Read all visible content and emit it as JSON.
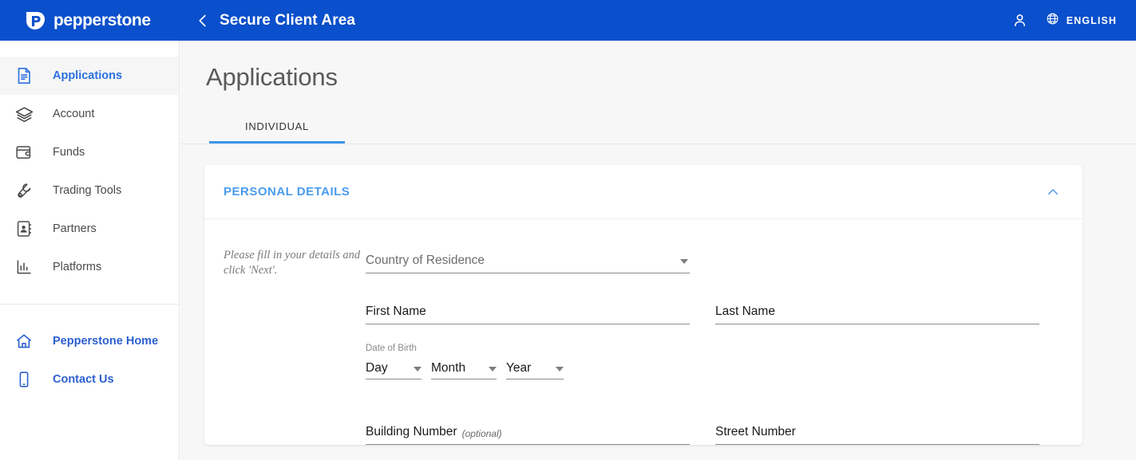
{
  "topbar": {
    "logo_word": "pepperstone",
    "logo_icon": "pepperstone-shield-logo",
    "back_icon": "chevron-left-icon",
    "title": "Secure Client Area",
    "account_icon": "person-icon",
    "globe_icon": "globe-icon",
    "language": "ENGLISH"
  },
  "sidebar": {
    "primary_items": [
      {
        "label": "Applications",
        "icon": "document-icon",
        "active": true
      },
      {
        "label": "Account",
        "icon": "layers-icon",
        "active": false
      },
      {
        "label": "Funds",
        "icon": "wallet-icon",
        "active": false
      },
      {
        "label": "Trading Tools",
        "icon": "wrench-icon",
        "active": false
      },
      {
        "label": "Partners",
        "icon": "contact-book-icon",
        "active": false
      },
      {
        "label": "Platforms",
        "icon": "bar-chart-icon",
        "active": false
      }
    ],
    "secondary_items": [
      {
        "label": "Pepperstone Home",
        "icon": "home-icon"
      },
      {
        "label": "Contact Us",
        "icon": "mobile-phone-icon"
      }
    ]
  },
  "main": {
    "page_title": "Applications",
    "tabs": [
      {
        "label": "INDIVIDUAL",
        "active": true
      }
    ],
    "card": {
      "section_title": "PERSONAL DETAILS",
      "collapse_icon": "chevron-up-icon",
      "helper_text": "Please fill in your details and click 'Next'.",
      "fields": {
        "country": {
          "label": "Country of Residence",
          "value": "",
          "type": "select"
        },
        "first_name": {
          "label": "First Name",
          "value": "",
          "type": "text"
        },
        "last_name": {
          "label": "Last Name",
          "value": "",
          "type": "text"
        },
        "dob": {
          "label": "Date of Birth",
          "day": "Day",
          "month": "Month",
          "year": "Year"
        },
        "building_number": {
          "label": "Building Number",
          "optional_note": "(optional)",
          "value": "",
          "type": "text"
        },
        "street_number": {
          "label": "Street Number",
          "value": "",
          "type": "text"
        }
      }
    }
  },
  "colors": {
    "brand_blue": "#0a4fcb",
    "accent_blue": "#2b6fe0",
    "tab_underline": "#3c96e8",
    "section_title": "#4a9bee",
    "page_bg": "#f7f7f7"
  }
}
